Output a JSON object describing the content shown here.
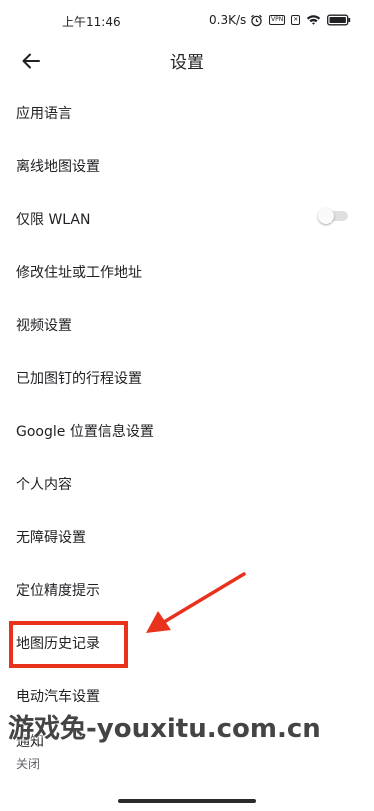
{
  "status_bar": {
    "time": "上午11:46",
    "network_speed": "0.3K/s",
    "vpn_badge": "VPN",
    "sim_badge": "✕"
  },
  "header": {
    "title": "设置"
  },
  "settings": {
    "items": [
      {
        "label": "应用语言"
      },
      {
        "label": "离线地图设置"
      },
      {
        "label": "仅限 WLAN",
        "toggle_on": false
      },
      {
        "label": "修改住址或工作地址"
      },
      {
        "label": "视频设置"
      },
      {
        "label": "已加图钉的行程设置"
      },
      {
        "label": "Google 位置信息设置"
      },
      {
        "label": "个人内容"
      },
      {
        "label": "无障碍设置"
      },
      {
        "label": "定位精度提示"
      },
      {
        "label": "地图历史记录"
      },
      {
        "label": "电动汽车设置"
      },
      {
        "label": "通知",
        "sublabel": "关闭"
      }
    ]
  },
  "annotation": {
    "highlight_color": "#e8321c"
  },
  "watermark": "游戏兔-youxitu.com.cn"
}
